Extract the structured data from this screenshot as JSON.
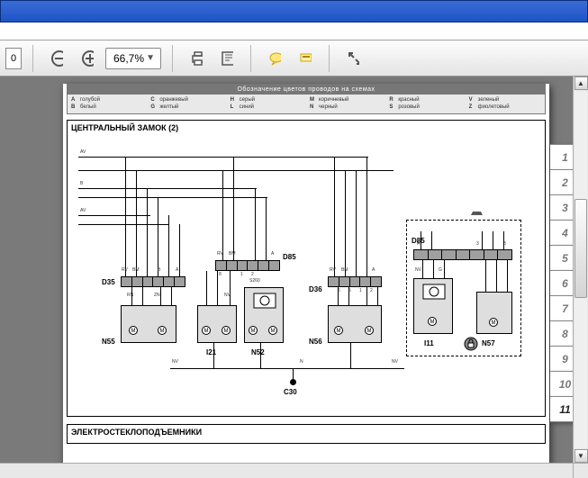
{
  "toolbar": {
    "page_field": "0",
    "zoom_value": "66,7%"
  },
  "legend": {
    "title": "Обозначение цветов проводов на схемах",
    "cols": [
      [
        {
          "code": "A",
          "name": "голубой"
        },
        {
          "code": "B",
          "name": "белый"
        }
      ],
      [
        {
          "code": "C",
          "name": "оранжевый"
        },
        {
          "code": "G",
          "name": "желтый"
        }
      ],
      [
        {
          "code": "H",
          "name": "серый"
        },
        {
          "code": "L",
          "name": "синий"
        }
      ],
      [
        {
          "code": "M",
          "name": "коричневый"
        },
        {
          "code": "N",
          "name": "черный"
        }
      ],
      [
        {
          "code": "R",
          "name": "красный"
        },
        {
          "code": "S",
          "name": "розовый"
        }
      ],
      [
        {
          "code": "V",
          "name": "зеленый"
        },
        {
          "code": "Z",
          "name": "фиолетовый"
        }
      ]
    ]
  },
  "section1": {
    "title": "ЦЕНТРАЛЬНЫЙ ЗАМОК (2)",
    "refs": {
      "D35": "D35",
      "D85": "D85",
      "D36": "D36",
      "D85b": "D85",
      "N55": "N55",
      "I21": "I21",
      "N52": "N52",
      "N56": "N56",
      "I11": "I11",
      "N57": "N57",
      "C30": "C30",
      "M": "M"
    },
    "pins": {
      "AV": "AV",
      "B": "B",
      "A": "A",
      "RV": "RV",
      "BM": "BM",
      "NV": "NV",
      "N": "N",
      "n1": "1",
      "n2": "2",
      "n3": "3",
      "n5": "5",
      "n6": "6",
      "n8": "8",
      "RN": "RN",
      "ZN": "ZN",
      "G": "G",
      "S260": "S260"
    }
  },
  "section2": {
    "title": "ЭЛЕКТРОСТЕКЛОПОДЪЕМНИКИ"
  },
  "tabs": [
    "1",
    "2",
    "3",
    "4",
    "5",
    "6",
    "7",
    "8",
    "9",
    "10",
    "11"
  ]
}
